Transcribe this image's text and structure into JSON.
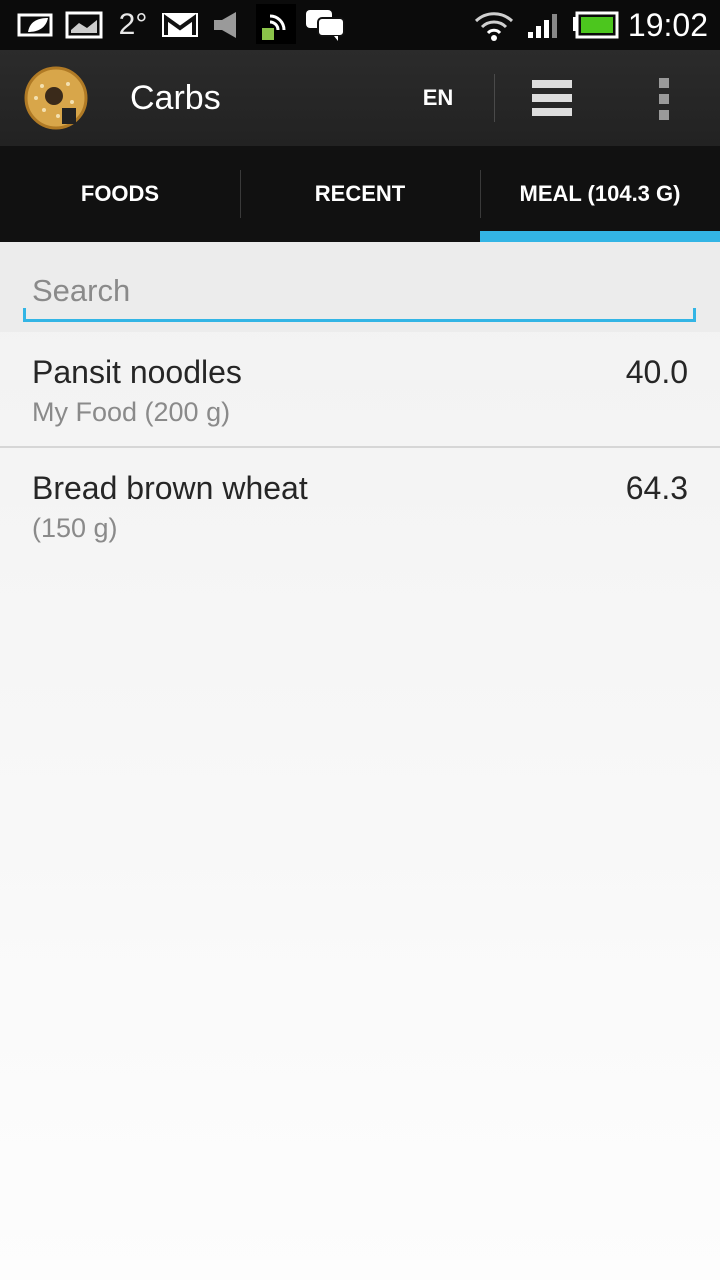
{
  "status_bar": {
    "temperature": "2°",
    "time": "19:02",
    "battery_color": "#4cc61e",
    "icons": [
      "weather-leaf-icon",
      "image-icon",
      "gmail-icon",
      "volume-icon",
      "cast-icon",
      "chat-icon",
      "wifi-icon",
      "signal-icon",
      "battery-icon"
    ]
  },
  "action_bar": {
    "title": "Carbs",
    "language": "EN"
  },
  "tabs": [
    {
      "label": "FOODS",
      "active": false
    },
    {
      "label": "RECENT",
      "active": false
    },
    {
      "label": "MEAL (104.3 G)",
      "active": true
    }
  ],
  "accent_color": "#33b5e5",
  "search": {
    "placeholder": "Search",
    "value": ""
  },
  "items": [
    {
      "name": "Pansit noodles",
      "detail": "My Food (200 g)",
      "value": "40.0"
    },
    {
      "name": "Bread brown wheat",
      "detail": "(150 g)",
      "value": "64.3"
    }
  ]
}
